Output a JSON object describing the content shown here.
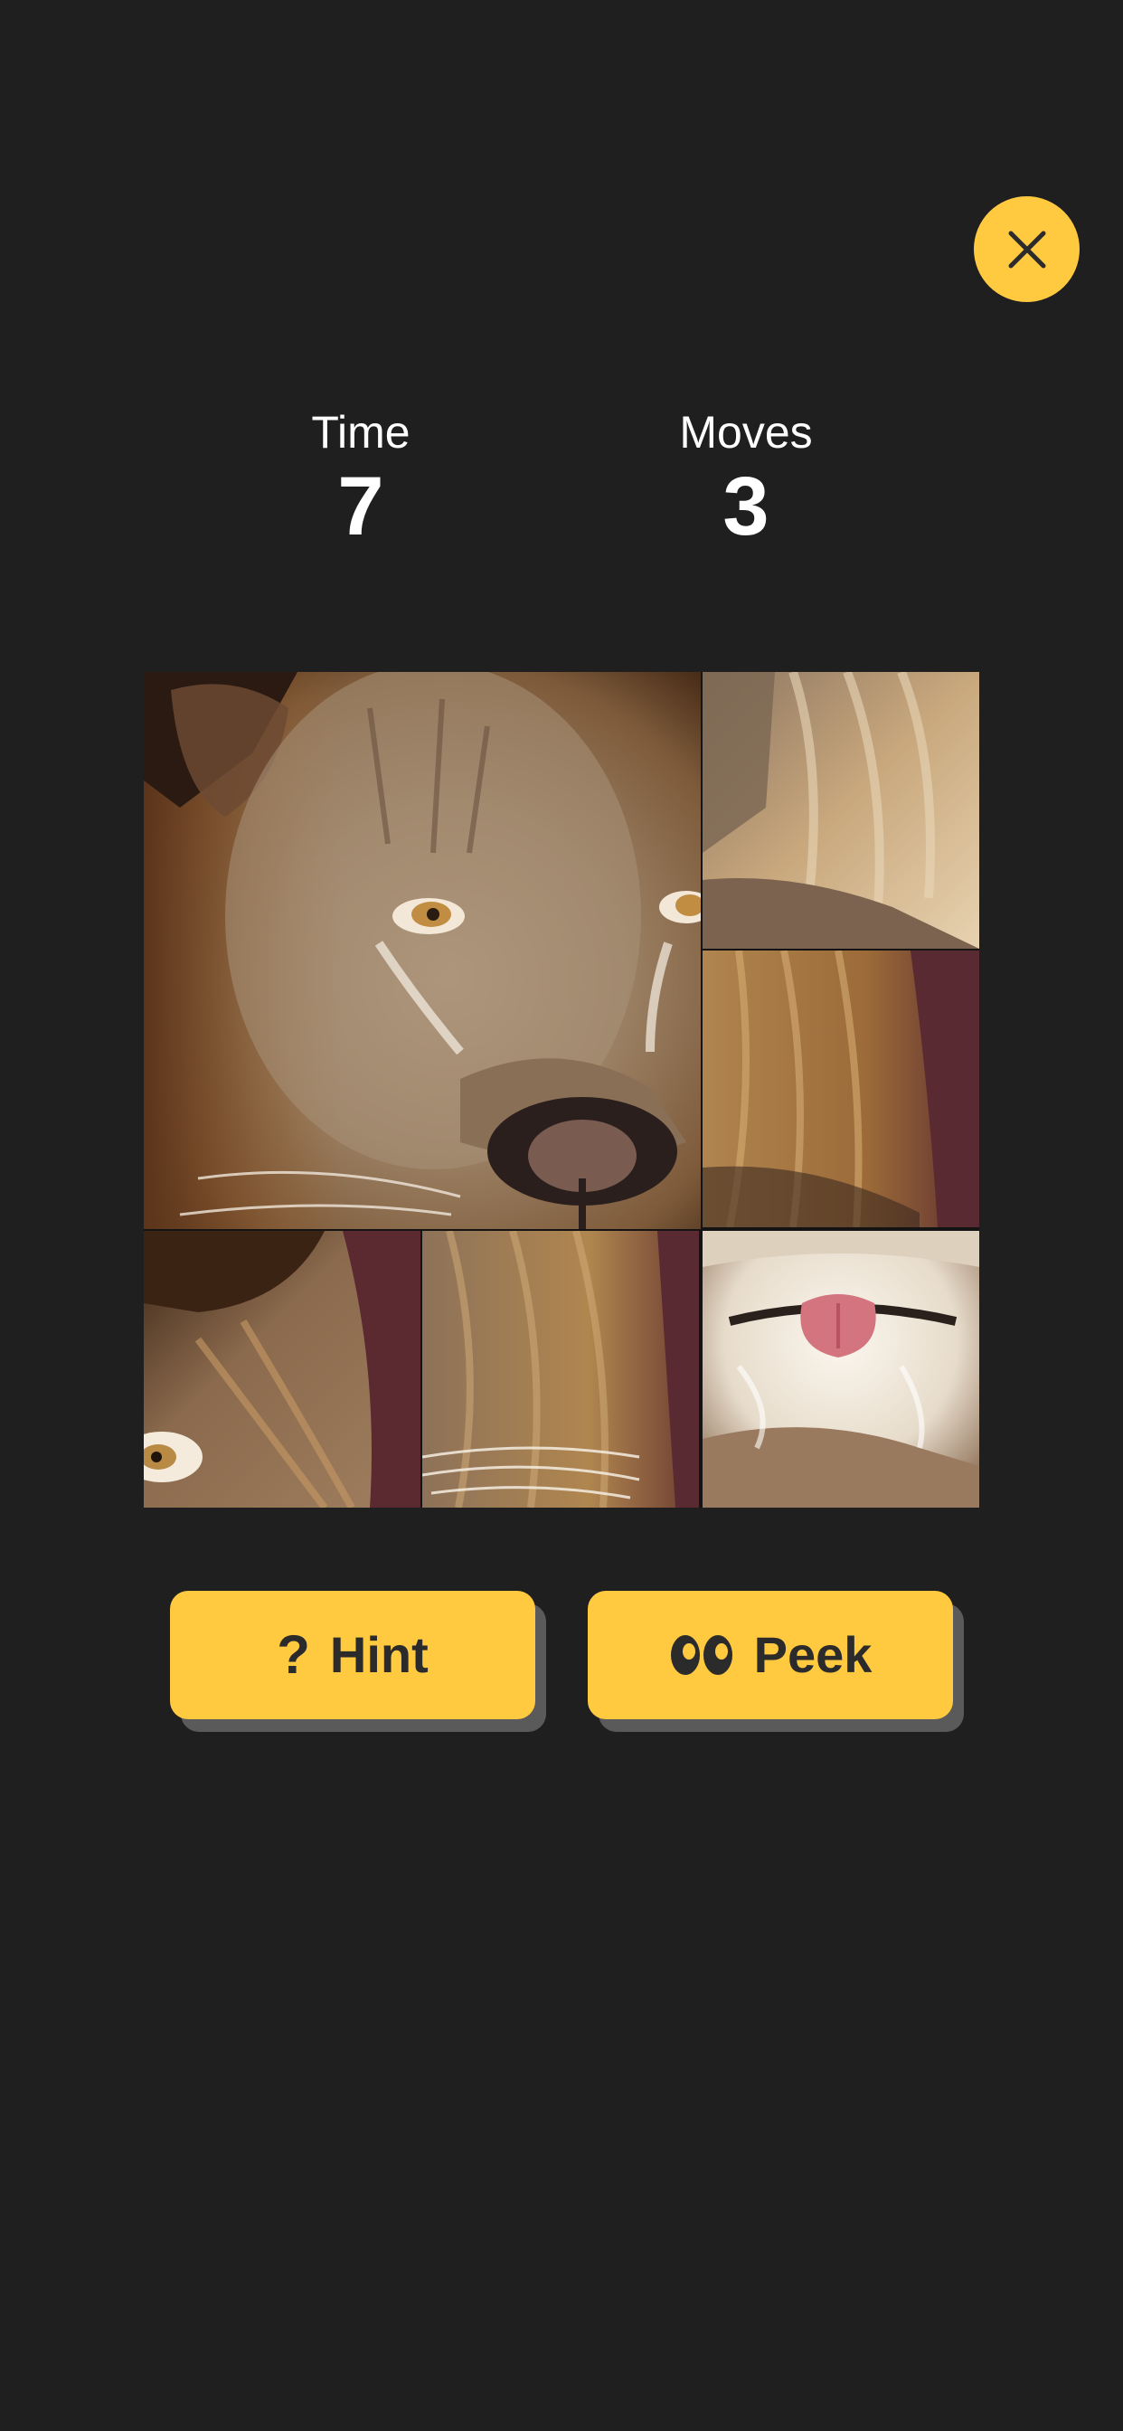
{
  "game": {
    "close_icon": "close-icon",
    "accent_color": "#FFC940",
    "background_color": "#1f1f1f"
  },
  "stats": {
    "time_label": "Time",
    "time_value": "7",
    "moves_label": "Moves",
    "moves_value": "3"
  },
  "puzzle": {
    "grid_size": 3,
    "image_subject": "lion",
    "tiles": [
      {
        "name": "tile-lion-face-large",
        "content": "lion face with eyes and nose"
      },
      {
        "name": "tile-mane-top-right",
        "content": "mane fur"
      },
      {
        "name": "tile-mane-middle-right",
        "content": "mane fur with red background"
      },
      {
        "name": "tile-eye-bottom-left",
        "content": "lion eye and mane"
      },
      {
        "name": "tile-whiskers-bottom-middle",
        "content": "mane and whiskers"
      },
      {
        "name": "tile-mouth-bottom-right",
        "content": "lion mouth with tongue"
      }
    ]
  },
  "actions": {
    "hint_icon": "question-mark-icon",
    "hint_glyph": "?",
    "hint_label": "Hint",
    "peek_icon": "eyes-icon",
    "peek_label": "Peek"
  }
}
